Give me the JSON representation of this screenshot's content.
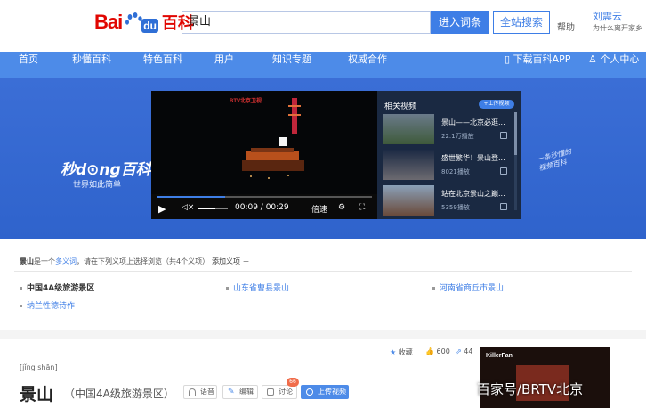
{
  "header": {
    "logo_bai": "Bai",
    "logo_du": "du",
    "logo_baike": "百科",
    "search_value": "景山",
    "enter_btn": "进入词条",
    "search_all_btn": "全站搜索",
    "help": "帮助",
    "user_name": "刘震云",
    "user_sub": "为什么离开家乡"
  },
  "nav": {
    "items": [
      "首页",
      "秒懂百科",
      "特色百科",
      "用户",
      "知识专题",
      "权威合作"
    ],
    "download": "下载百科APP",
    "personal": "个人中心"
  },
  "banner": {
    "logo": "秒d⊙ng百科",
    "slogan": "世界如此简单",
    "handwriting": "一条秒懂的\n视频百科",
    "player": {
      "channel": "BTV北京卫视",
      "time": "00:09 / 00:29",
      "speed": "倍速",
      "progress": 0.32,
      "volume": 0.6
    },
    "related": {
      "title": "相关视频",
      "upload": "+上传视频",
      "items": [
        {
          "title": "景山——北京必逛...",
          "count": "22.1万播放"
        },
        {
          "title": "盛世繁华！景山登...",
          "count": "8021播放"
        },
        {
          "title": "站在北京景山之巅...",
          "count": "5359播放"
        }
      ]
    }
  },
  "polysemy": {
    "term": "景山",
    "text_a": "是一个",
    "link": "多义词",
    "text_b": "，请在下列义项上选择浏览（共4个义项）",
    "add": "添加义项 ＋",
    "meanings": [
      "中国4A级旅游景区",
      "山东省曹县景山",
      "河南省商丘市景山",
      "纳兰性德诗作"
    ]
  },
  "entry": {
    "pinyin": "[jǐng shān]",
    "title": "景山",
    "subtitle": "（中国4A级旅游景区）",
    "buttons": {
      "voice": "语音",
      "edit": "编辑",
      "discuss": "讨论",
      "upload": "上传视频"
    },
    "discuss_badge": "66",
    "collect": "收藏",
    "likes": "600",
    "shares": "44"
  },
  "thumb": {
    "label": "KillerFan",
    "watermark": "百家号/BRTV北京"
  },
  "colors": {
    "brand_red": "#e10601",
    "accent_blue": "#4d8be8",
    "banner_blue": "#3b6ed6"
  }
}
